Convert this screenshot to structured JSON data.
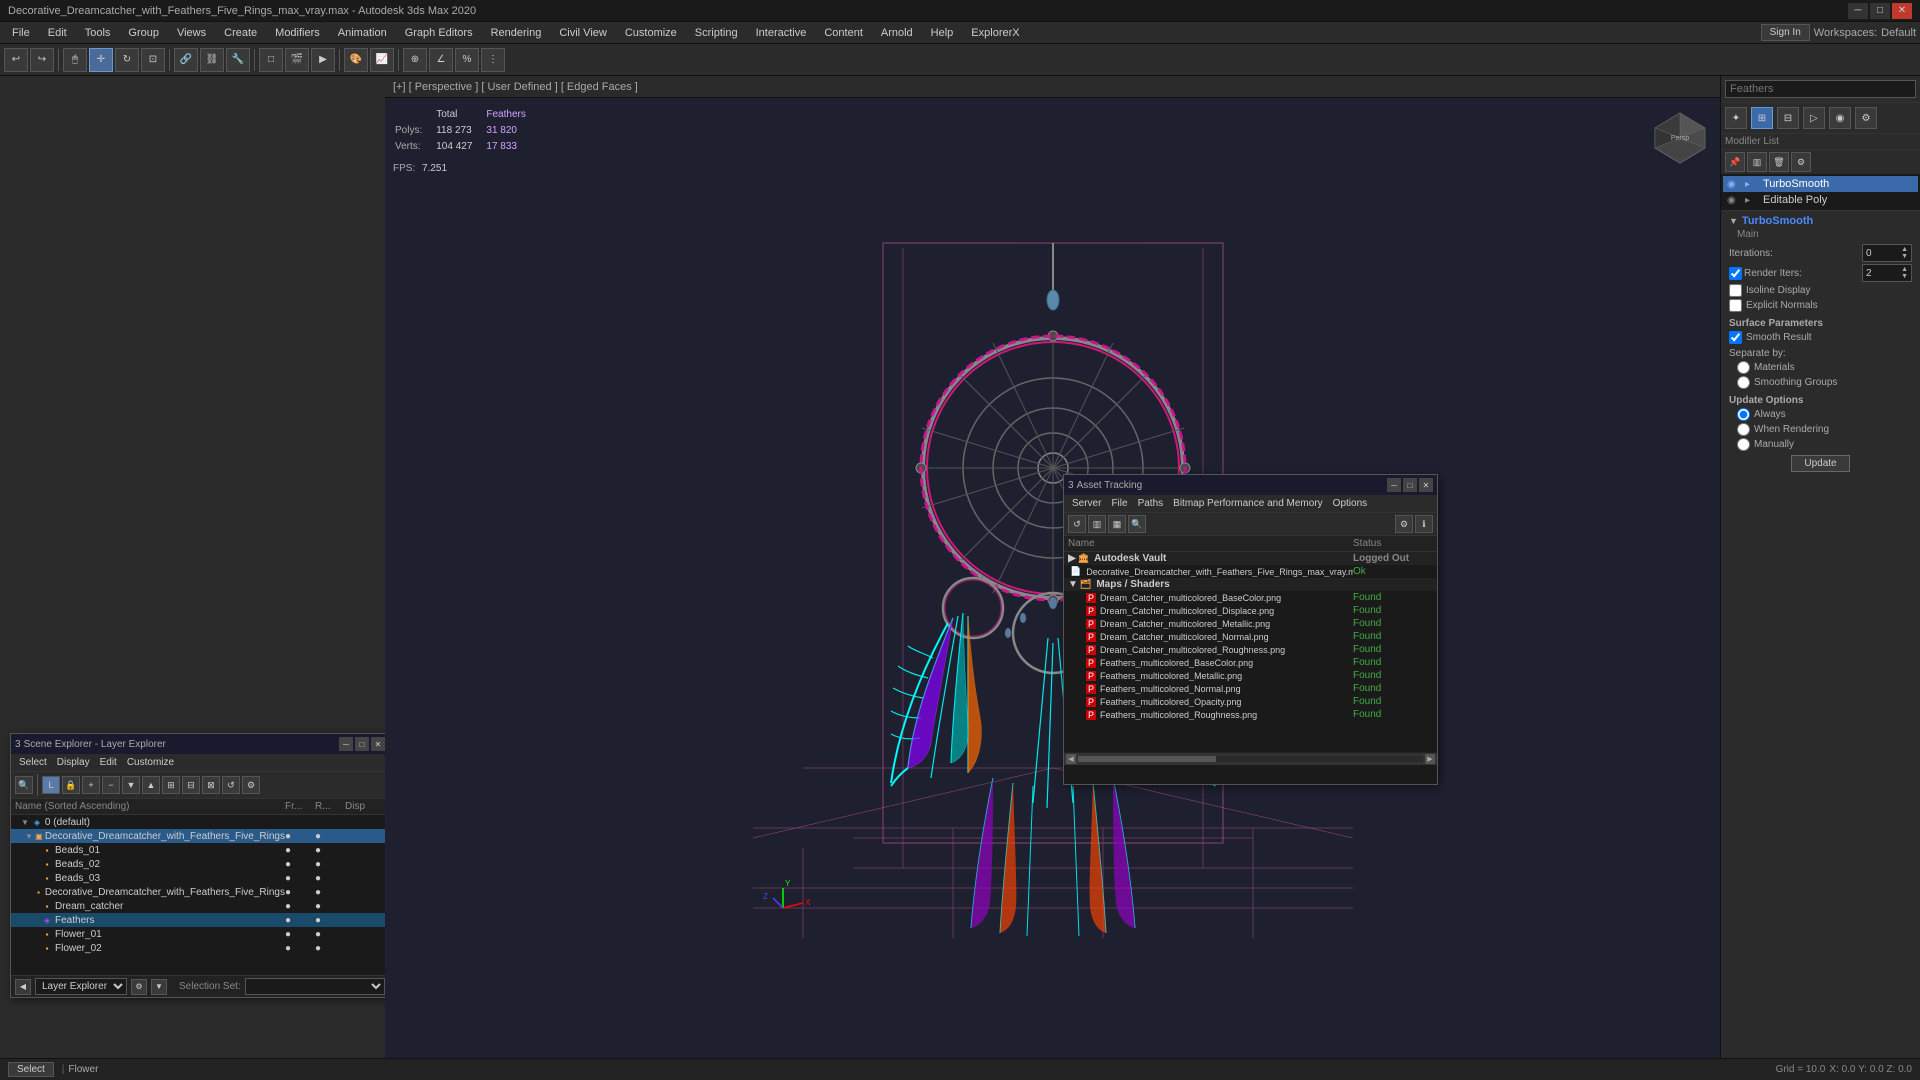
{
  "titlebar": {
    "title": "Decorative_Dreamcatcher_with_Feathers_Five_Rings_max_vray.max - Autodesk 3ds Max 2020",
    "min": "─",
    "max": "□",
    "close": "✕"
  },
  "menubar": {
    "items": [
      "File",
      "Edit",
      "Tools",
      "Group",
      "Views",
      "Create",
      "Modifiers",
      "Animation",
      "Graph Editors",
      "Rendering",
      "Civil View",
      "Customize",
      "Scripting",
      "Interactive",
      "Content",
      "Arnold",
      "Help",
      "ExplorerX"
    ]
  },
  "toolbar": {
    "sign_in": "Sign In",
    "workspaces_label": "Workspaces:",
    "workspace_name": "Default"
  },
  "viewport": {
    "header": "[+] [ Perspective ] [ User Defined ] [ Edged Faces ]",
    "stats": {
      "polys_label": "Polys:",
      "verts_label": "Verts:",
      "polys_total": "118 273",
      "polys_feathers": "31 820",
      "verts_total": "104 427",
      "verts_feathers": "17 833",
      "fps_label": "FPS:",
      "fps_value": "7.251",
      "total_label": "Total",
      "feathers_label": "Feathers"
    }
  },
  "right_panel": {
    "search_placeholder": "Feathers",
    "modifier_list_label": "Modifier List",
    "modifiers": [
      {
        "name": "TurboSmooth",
        "active": true
      },
      {
        "name": "Editable Poly",
        "active": false
      }
    ],
    "turbosmooth_section": "TurboSmooth",
    "main_label": "Main",
    "iterations_label": "Iterations:",
    "iterations_value": "0",
    "render_iters_label": "Render Iters:",
    "render_iters_value": "2",
    "isoline_display": "Isoline Display",
    "explicit_normals": "Explicit Normals",
    "surface_parameters": "Surface Parameters",
    "smooth_result": "Smooth Result",
    "separate_by": "Separate by:",
    "materials": "Materials",
    "smoothing_groups": "Smoothing Groups",
    "update_options": "Update Options",
    "always": "Always",
    "when_rendering": "When Rendering",
    "manually": "Manually",
    "update_btn": "Update"
  },
  "scene_explorer": {
    "title": "Scene Explorer - Layer Explorer",
    "menus": [
      "Select",
      "Display",
      "Edit",
      "Customize"
    ],
    "col_name": "Name (Sorted Ascending)",
    "col_fr": "Fr...",
    "col_r": "R...",
    "col_disp": "Disp",
    "items": [
      {
        "name": "0 (default)",
        "level": 0,
        "type": "layer",
        "expanded": true
      },
      {
        "name": "Decorative_Dreamcatcher_with_Feathers_Five_Rings",
        "level": 1,
        "type": "group",
        "expanded": true,
        "selected": true
      },
      {
        "name": "Beads_01",
        "level": 2,
        "type": "obj"
      },
      {
        "name": "Beads_02",
        "level": 2,
        "type": "obj"
      },
      {
        "name": "Beads_03",
        "level": 2,
        "type": "obj"
      },
      {
        "name": "Decorative_Dreamcatcher_with_Feathers_Five_Rings",
        "level": 2,
        "type": "obj"
      },
      {
        "name": "Dream_catcher",
        "level": 2,
        "type": "obj"
      },
      {
        "name": "Feathers",
        "level": 2,
        "type": "obj",
        "highlighted": true
      },
      {
        "name": "Flower_01",
        "level": 2,
        "type": "obj"
      },
      {
        "name": "Flower_02",
        "level": 2,
        "type": "obj"
      }
    ],
    "footer_layer_label": "Layer Explorer",
    "selection_set_label": "Selection Set:"
  },
  "asset_tracking": {
    "title": "Asset Tracking",
    "menus": [
      "Server",
      "File",
      "Paths",
      "Bitmap Performance and Memory",
      "Options"
    ],
    "col_name": "Name",
    "col_status": "Status",
    "groups": [
      {
        "name": "Autodesk Vault",
        "status": "Logged Out",
        "items": [
          {
            "name": "Decorative_Dreamcatcher_with_Feathers_Five_Rings_max_vray.max",
            "status": "Ok",
            "level": 1,
            "icon": "file"
          }
        ]
      },
      {
        "name": "Maps / Shaders",
        "status": "",
        "items": [
          {
            "name": "Dream_Catcher_multicolored_BaseColor.png",
            "status": "Found",
            "level": 1,
            "icon": "png"
          },
          {
            "name": "Dream_Catcher_multicolored_Displace.png",
            "status": "Found",
            "level": 1,
            "icon": "png"
          },
          {
            "name": "Dream_Catcher_multicolored_Metallic.png",
            "status": "Found",
            "level": 1,
            "icon": "png"
          },
          {
            "name": "Dream_Catcher_multicolored_Normal.png",
            "status": "Found",
            "level": 1,
            "icon": "png"
          },
          {
            "name": "Dream_Catcher_multicolored_Roughness.png",
            "status": "Found",
            "level": 1,
            "icon": "png"
          },
          {
            "name": "Feathers_multicolored_BaseColor.png",
            "status": "Found",
            "level": 1,
            "icon": "png"
          },
          {
            "name": "Feathers_multicolored_Metallic.png",
            "status": "Found",
            "level": 1,
            "icon": "png"
          },
          {
            "name": "Feathers_multicolored_Normal.png",
            "status": "Found",
            "level": 1,
            "icon": "png"
          },
          {
            "name": "Feathers_multicolored_Opacity.png",
            "status": "Found",
            "level": 1,
            "icon": "png"
          },
          {
            "name": "Feathers_multicolored_Roughness.png",
            "status": "Found",
            "level": 1,
            "icon": "png"
          }
        ]
      }
    ]
  },
  "statusbar": {
    "select_label": "Select",
    "flower_label": "Flower"
  }
}
